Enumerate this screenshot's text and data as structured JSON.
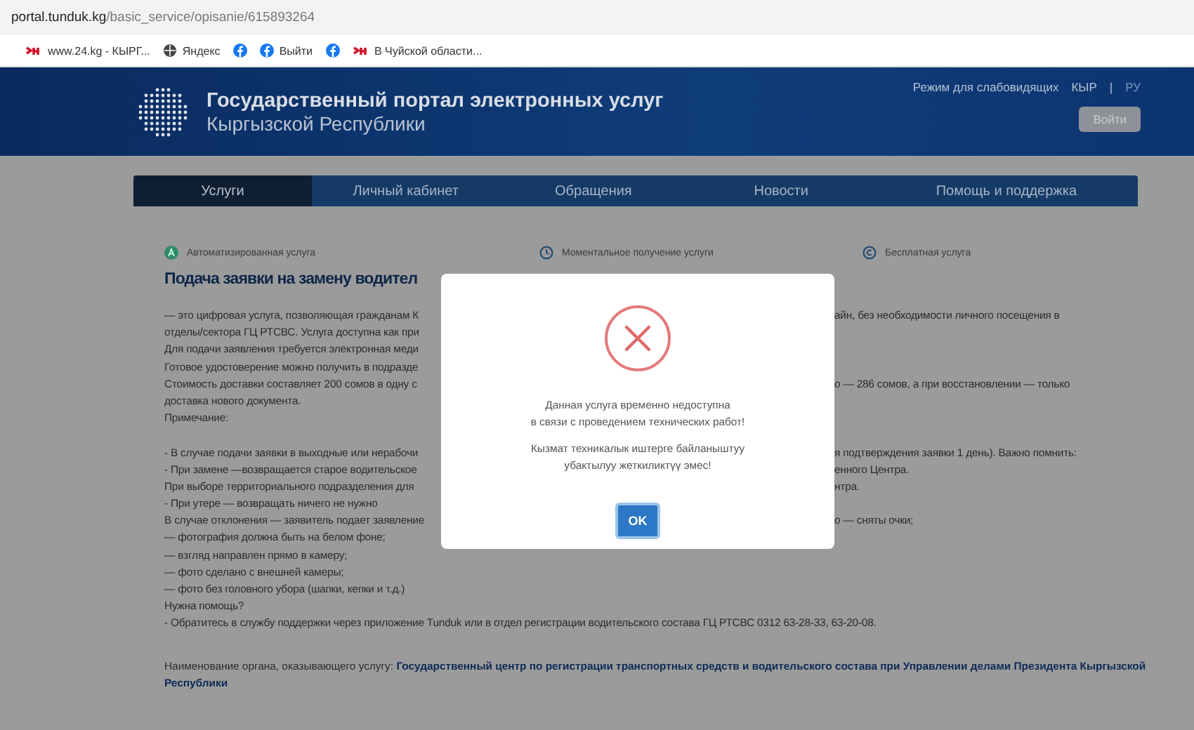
{
  "browser": {
    "url_domain": "portal.tunduk.kg",
    "url_path": "/basic_service/opisanie/615893264",
    "bookmarks": [
      {
        "kind": "news24",
        "label": "www.24.kg - КЫРГ..."
      },
      {
        "kind": "yandex",
        "label": "Яндекс"
      },
      {
        "kind": "facebook"
      },
      {
        "kind": "facebook",
        "label": "Выйти"
      },
      {
        "kind": "facebook"
      },
      {
        "kind": "news24",
        "label": "В Чуйской области..."
      }
    ]
  },
  "header": {
    "title": "Государственный портал электронных услуг",
    "subtitle": "Кыргызской Республики",
    "accessibility": "Режим для слабовидящих",
    "language_separator": "|",
    "languages": [
      {
        "label": "КЫР",
        "selected": false
      },
      {
        "label": "РУ",
        "selected": true
      }
    ],
    "login": "Войти"
  },
  "nav": [
    {
      "label": "Услуги",
      "selected": true
    },
    {
      "label": "Личный кабинет",
      "selected": false
    },
    {
      "label": "Обращения",
      "selected": false
    },
    {
      "label": "Новости",
      "selected": false
    },
    {
      "label": "Помощь и поддержка",
      "selected": false
    }
  ],
  "features": [
    {
      "kind": "automated",
      "label": "Автоматизированная услуга"
    },
    {
      "kind": "instant",
      "label": "Моментальное получение услуги"
    },
    {
      "kind": "free",
      "label": "Бесплатная услуга"
    }
  ],
  "heading": "Подача заявки на замену водител",
  "lines": [
    {
      "kind": "text",
      "left": "— это цифровая услуга, позволяющая гражданам К",
      "right": "айн, без необходимости личного посещения в"
    },
    {
      "kind": "text",
      "left": "отделы/сектора ГЦ РТСВС. Услуга доступна как при"
    },
    {
      "kind": "text",
      "left": "Для подачи заявления требуется электронная меди"
    },
    {
      "kind": "text",
      "left": "Готовое удостоверение можно получить в подразде"
    },
    {
      "kind": "text",
      "left": "Стоимость доставки составляет 200 сомов в одну с",
      "right": "о — 286 сомов, а при восстановлении — только"
    },
    {
      "kind": "text",
      "left": "доставка нового документа."
    },
    {
      "kind": "text",
      "left": "Примечание:"
    },
    {
      "kind": "blank"
    },
    {
      "kind": "text",
      "left": "- В случае подачи заявки в выходные или нерабочи",
      "right": "я подтверждения заявки 1 день). Важно помнить:"
    },
    {
      "kind": "text",
      "left": "- При замене —возвращается старое водительское",
      "right": "енного Центра."
    },
    {
      "kind": "text",
      "left": "При выборе территориального подразделения для",
      "right": "нтра."
    },
    {
      "kind": "text",
      "left": "- При утере — возвращать ничего не нужно"
    },
    {
      "kind": "text",
      "left": "В случае отклонения — заявитель подает заявление",
      "right": "о — сняты очки;"
    },
    {
      "kind": "text",
      "left": "— фотография должна быть на белом фоне;"
    },
    {
      "kind": "text",
      "left": "— взгляд направлен прямо в камеру;"
    },
    {
      "kind": "text",
      "left": "— фото сделано с внешней камеры;"
    },
    {
      "kind": "text",
      "left": "— фото без головного убора (шапки, кепки и т.д.)"
    },
    {
      "kind": "text",
      "left": "Нужна помощь?"
    },
    {
      "kind": "text",
      "left": "- Обратитесь в службу поддержки через приложение Tunduk или в отдел регистрации водительского состава ГЦ РТСВС 0312 63-28-33, 63-20-08."
    }
  ],
  "provider": "Наименование органа, оказывающего услугу: **Государственный центр по регистрации транспортных средств и водительского состава при Управлении делами Президента Кыргызской Республики**",
  "dialog": {
    "messages": [
      "Данная услуга временно недоступна\nв связи с проведением технических работ!",
      "Кызмат техникалык иштерге байланыштуу\nубактылуу жеткиликтүү эмес!"
    ],
    "button": "OK"
  }
}
